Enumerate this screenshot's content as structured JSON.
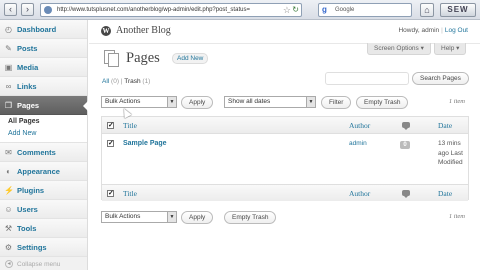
{
  "browser": {
    "url": "http://www.tutsplusnet.com/anotherblog/wp-admin/edit.php?post_status=",
    "search_text": "Google",
    "ext_label": "SEW"
  },
  "header": {
    "site_title": "Another Blog",
    "howdy": "Howdy, admin",
    "logout": "Log Out",
    "screen_options": "Screen Options ▾",
    "help": "Help ▾"
  },
  "sidebar": {
    "items": [
      {
        "label": "Dashboard",
        "icon": "dashboard-icon"
      },
      {
        "label": "Posts",
        "icon": "posts-icon"
      },
      {
        "label": "Media",
        "icon": "media-icon"
      },
      {
        "label": "Links",
        "icon": "links-icon"
      },
      {
        "label": "Pages",
        "icon": "pages-icon"
      },
      {
        "label": "Comments",
        "icon": "comments-icon"
      },
      {
        "label": "Appearance",
        "icon": "appearance-icon"
      },
      {
        "label": "Plugins",
        "icon": "plugins-icon"
      },
      {
        "label": "Users",
        "icon": "users-icon"
      },
      {
        "label": "Tools",
        "icon": "tools-icon"
      },
      {
        "label": "Settings",
        "icon": "settings-icon"
      }
    ],
    "sub_items": [
      "All Pages",
      "Add New"
    ],
    "collapse": "Collapse menu"
  },
  "main": {
    "title": "Pages",
    "add_new": "Add New",
    "status_all": "All",
    "status_all_count": "(0)",
    "status_sep": "|",
    "status_trash": "Trash",
    "status_trash_count": "(1)",
    "search_button": "Search Pages",
    "bulk_actions": "Bulk Actions",
    "apply": "Apply",
    "dates": "Show all dates",
    "filter": "Filter",
    "empty_trash": "Empty Trash",
    "item_count": "1 item"
  },
  "table": {
    "columns": {
      "title": "Title",
      "author": "Author",
      "date": "Date"
    },
    "rows": [
      {
        "title": "Sample Page",
        "author": "admin",
        "comments": "0",
        "date": "13 mins ago Last Modified"
      }
    ]
  },
  "colors": {
    "link": "#21759b",
    "active_menu": "#6d6d6d"
  }
}
